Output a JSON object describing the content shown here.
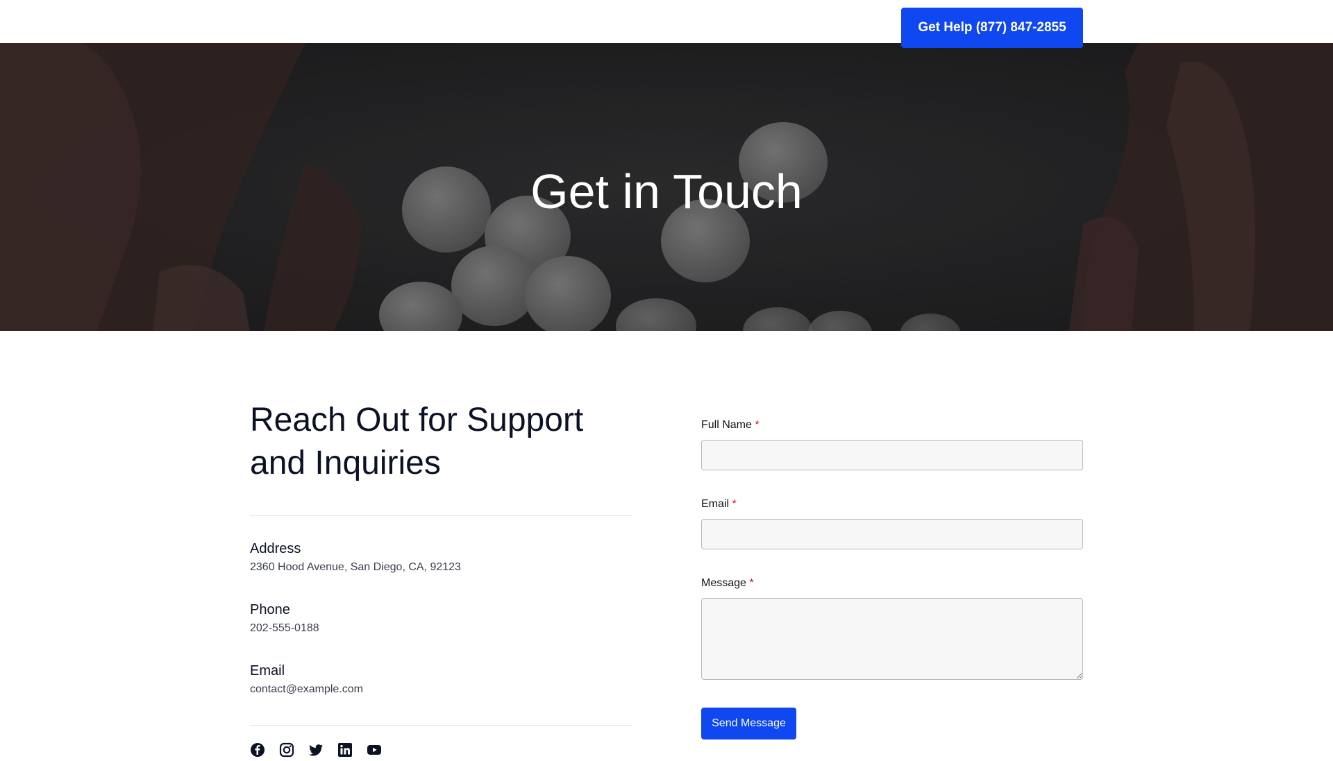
{
  "header": {
    "cta_label": "Get Help (877) 847-2855"
  },
  "hero": {
    "title": "Get in Touch"
  },
  "contact_info": {
    "heading": "Reach Out for Support and Inquiries",
    "address_label": "Address",
    "address_value": "2360 Hood Avenue, San Diego, CA, 92123",
    "phone_label": "Phone",
    "phone_value": "202-555-0188",
    "email_label": "Email",
    "email_value": "contact@example.com",
    "socials": [
      "facebook-icon",
      "instagram-icon",
      "twitter-icon",
      "linkedin-icon",
      "youtube-icon"
    ]
  },
  "form": {
    "full_name_label": "Full Name",
    "email_label": "Email",
    "message_label": "Message",
    "required_marker": "*",
    "full_name_value": "",
    "email_value": "",
    "message_value": "",
    "submit_label": "Send Message"
  },
  "colors": {
    "accent": "#0f47f0",
    "heading": "#0b1226",
    "required": "#d01a1a"
  }
}
